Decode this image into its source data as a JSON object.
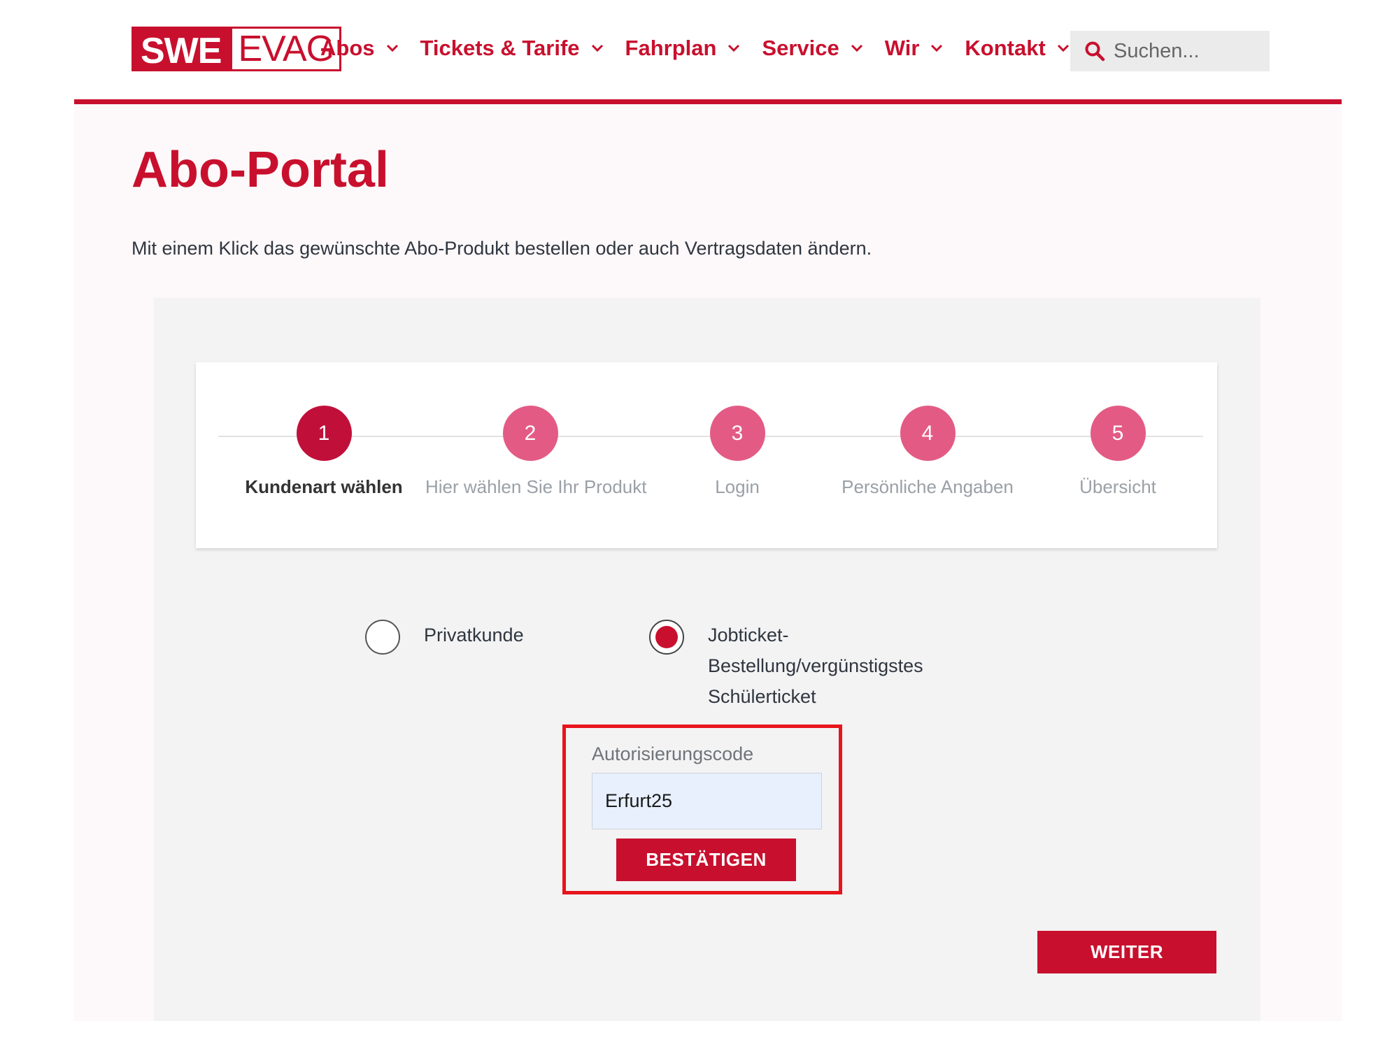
{
  "header": {
    "logo": {
      "part1": "SWE",
      "part2": "EVAG"
    },
    "nav": [
      {
        "label": "Abos"
      },
      {
        "label": "Tickets & Tarife"
      },
      {
        "label": "Fahrplan"
      },
      {
        "label": "Service"
      },
      {
        "label": "Wir"
      },
      {
        "label": "Kontakt"
      }
    ],
    "search": {
      "placeholder": "Suchen...",
      "icon": "search-icon"
    }
  },
  "main": {
    "title": "Abo-Portal",
    "intro": "Mit einem Klick das gewünschte Abo-Produkt bestellen oder auch Vertragsdaten ändern.",
    "steps": [
      {
        "number": "1",
        "label": "Kundenart wählen",
        "active": true
      },
      {
        "number": "2",
        "label": "Hier wählen Sie Ihr Produkt",
        "active": false
      },
      {
        "number": "3",
        "label": "Login",
        "active": false
      },
      {
        "number": "4",
        "label": "Persönliche Angaben",
        "active": false
      },
      {
        "number": "5",
        "label": "Übersicht",
        "active": false
      }
    ],
    "customer_types": [
      {
        "label": "Privatkunde",
        "checked": false
      },
      {
        "label_lines": [
          "Jobticket-",
          "Bestellung/vergünstigstes",
          "Schülerticket"
        ],
        "checked": true
      }
    ],
    "auth": {
      "label": "Autorisierungscode",
      "value": "Erfurt25",
      "confirm_label": "BESTÄTIGEN"
    },
    "next_label": "WEITER"
  },
  "colors": {
    "brand": "#c8102e",
    "step_active": "#c0103a",
    "step_inactive": "#e35b84",
    "highlight_border": "#e8141c",
    "panel_bg": "#f3f3f3"
  }
}
